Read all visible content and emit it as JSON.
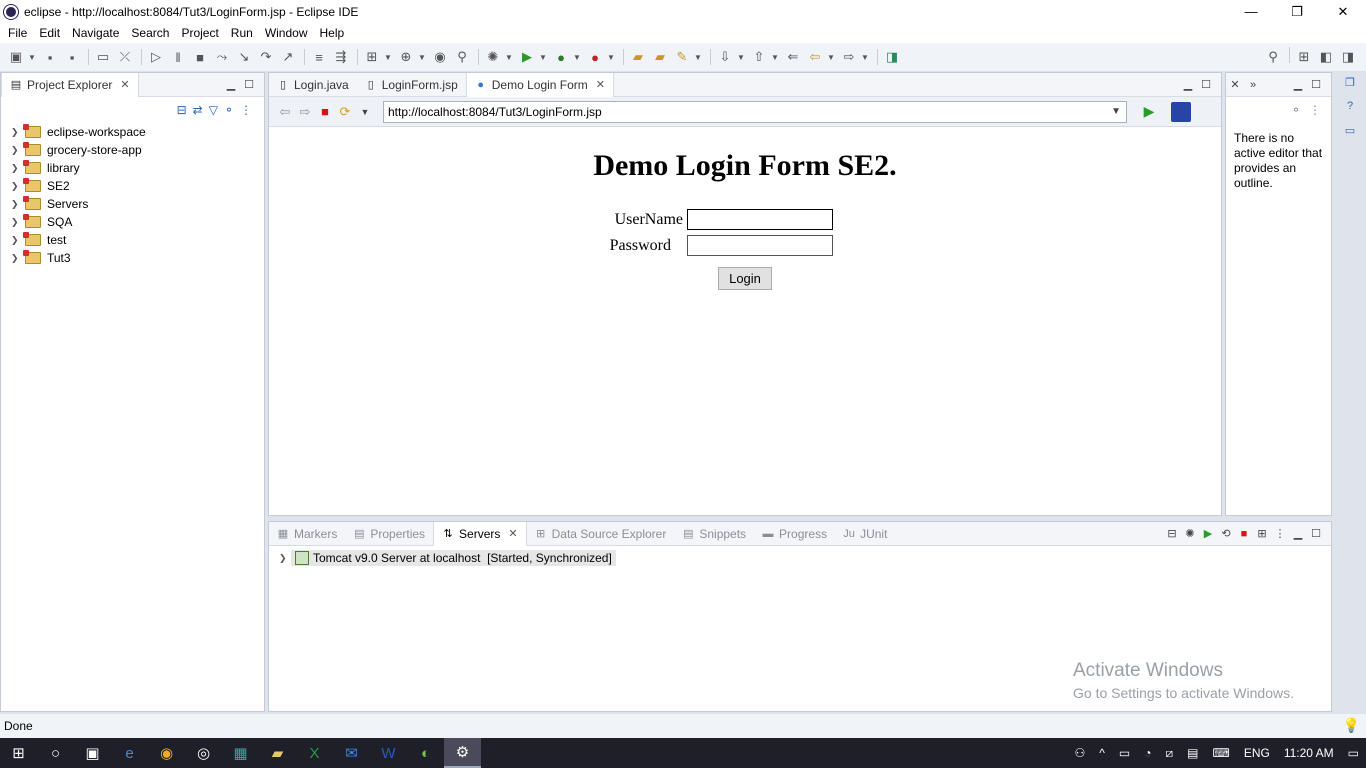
{
  "window": {
    "title": "eclipse - http://localhost:8084/Tut3/LoginForm.jsp - Eclipse IDE",
    "min": "—",
    "restore": "❐",
    "close": "✕"
  },
  "menu": [
    "File",
    "Edit",
    "Navigate",
    "Search",
    "Project",
    "Run",
    "Window",
    "Help"
  ],
  "project_explorer": {
    "tab": "Project Explorer",
    "items": [
      "eclipse-workspace",
      "grocery-store-app",
      "library",
      "SE2",
      "Servers",
      "SQA",
      "test",
      "Tut3"
    ]
  },
  "editor": {
    "tabs": [
      {
        "label": "Login.java"
      },
      {
        "label": "LoginForm.jsp"
      },
      {
        "label": "Demo Login Form"
      }
    ],
    "url": "http://localhost:8084/Tut3/LoginForm.jsp",
    "page": {
      "heading": "Demo Login Form SE2.",
      "username_label": "UserName",
      "password_label": "Password",
      "login_button": "Login"
    }
  },
  "outline": {
    "message": "There is no active editor that provides an outline."
  },
  "bottom_panel": {
    "tabs": [
      "Markers",
      "Properties",
      "Servers",
      "Data Source Explorer",
      "Snippets",
      "Progress",
      "JUnit"
    ],
    "server_entry": "Tomcat v9.0 Server at localhost  [Started, Synchronized]"
  },
  "watermark": {
    "line1": "Activate Windows",
    "line2": "Go to Settings to activate Windows."
  },
  "status": "Done",
  "taskbar": {
    "lang": "ENG",
    "time": "11:20 AM"
  },
  "colors": {
    "accent": "#2a66b8",
    "taskbar": "#1f1f2a",
    "stop": "#dd1111"
  }
}
